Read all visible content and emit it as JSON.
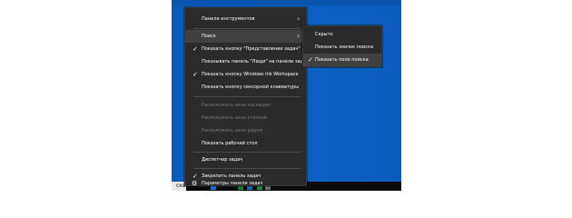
{
  "desktop": {
    "accent_color": "#0d63c6"
  },
  "context_menu": {
    "items": [
      {
        "label": "Панели инструментов",
        "icon": "chevron-right",
        "enabled": true,
        "checked": false
      },
      {
        "label": "Поиск",
        "icon": "chevron-right",
        "enabled": true,
        "checked": false,
        "highlighted": true
      },
      {
        "label": "Показать кнопку \"Представление задач\"",
        "enabled": true,
        "checked": true
      },
      {
        "label": "Показывать панель \"Люди\" на панели задач",
        "enabled": true,
        "checked": false
      },
      {
        "label": "Показать кнопку Windows Ink Workspace",
        "enabled": true,
        "checked": true
      },
      {
        "label": "Показать кнопку сенсорной клавиатуры",
        "enabled": true,
        "checked": false
      },
      {
        "label": "Расположить окна каскадом",
        "enabled": false,
        "checked": false
      },
      {
        "label": "Расположить окна стопкой",
        "enabled": false,
        "checked": false
      },
      {
        "label": "Расположить окна рядом",
        "enabled": false,
        "checked": false
      },
      {
        "label": "Показать рабочий стол",
        "enabled": true,
        "checked": false
      },
      {
        "label": "Диспетчер задач",
        "enabled": true,
        "checked": false
      },
      {
        "label": "Закрепить панель задач",
        "enabled": true,
        "checked": true
      },
      {
        "label": "Параметры панели задач",
        "icon": "gear",
        "enabled": true,
        "checked": false
      }
    ]
  },
  "search_submenu": {
    "items": [
      {
        "label": "Скрыто",
        "checked": false
      },
      {
        "label": "Показать значок поиска",
        "checked": false
      },
      {
        "label": "Показать поле поиска",
        "checked": true,
        "highlighted": true
      }
    ]
  },
  "taskbar": {
    "left_text": "ско"
  },
  "icons": {
    "check": "✓",
    "chevron_right": "›",
    "gear": "⚙"
  }
}
